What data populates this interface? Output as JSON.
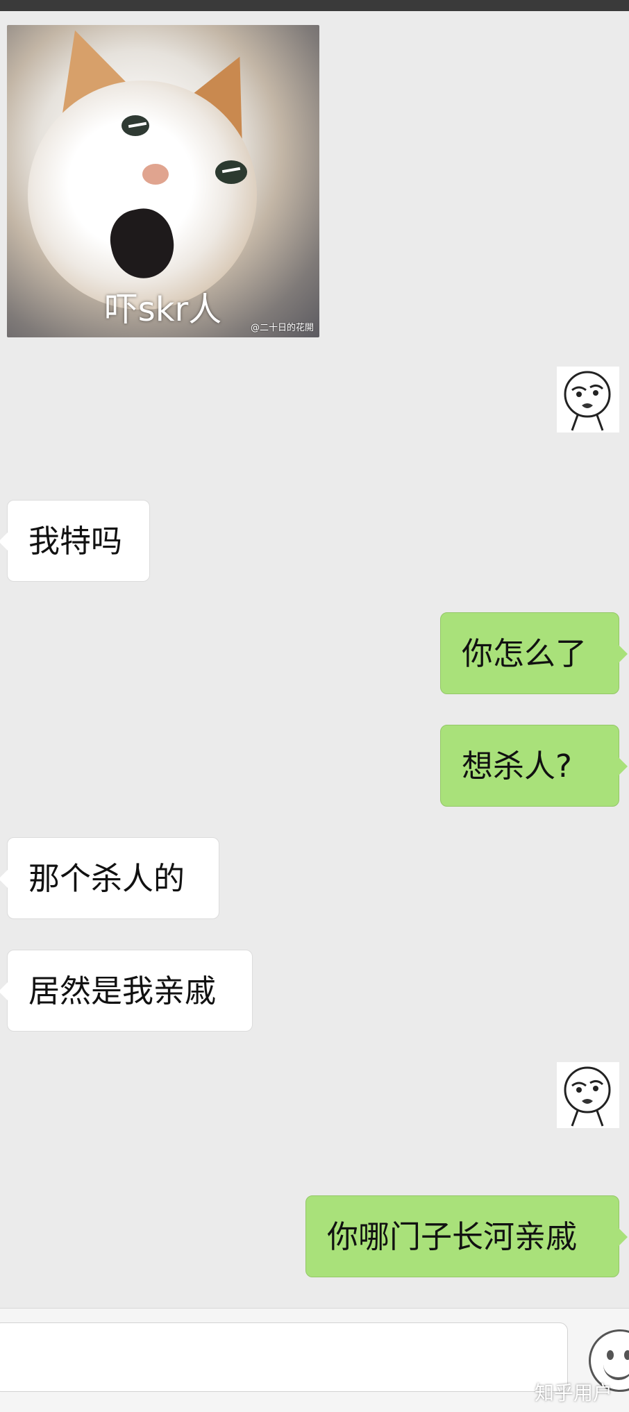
{
  "meme": {
    "caption": "吓skr人",
    "watermark": "@二十日的花開"
  },
  "messages": [
    {
      "side": "left",
      "text": "我特吗"
    },
    {
      "side": "right",
      "text": "你怎么了"
    },
    {
      "side": "right",
      "text": "想杀人?"
    },
    {
      "side": "left",
      "text": "那个杀人的"
    },
    {
      "side": "left",
      "text": "居然是我亲戚"
    },
    {
      "side": "right",
      "text": "你哪门子长河亲戚"
    }
  ],
  "input": {
    "placeholder": ""
  },
  "watermark": "知乎用户",
  "colors": {
    "chat_bg": "#ebebeb",
    "outgoing_bubble": "#a9e17a",
    "incoming_bubble": "#ffffff"
  },
  "icons": {
    "sticker_avatar": "face-sticker-icon",
    "emoji": "emoji-icon"
  }
}
